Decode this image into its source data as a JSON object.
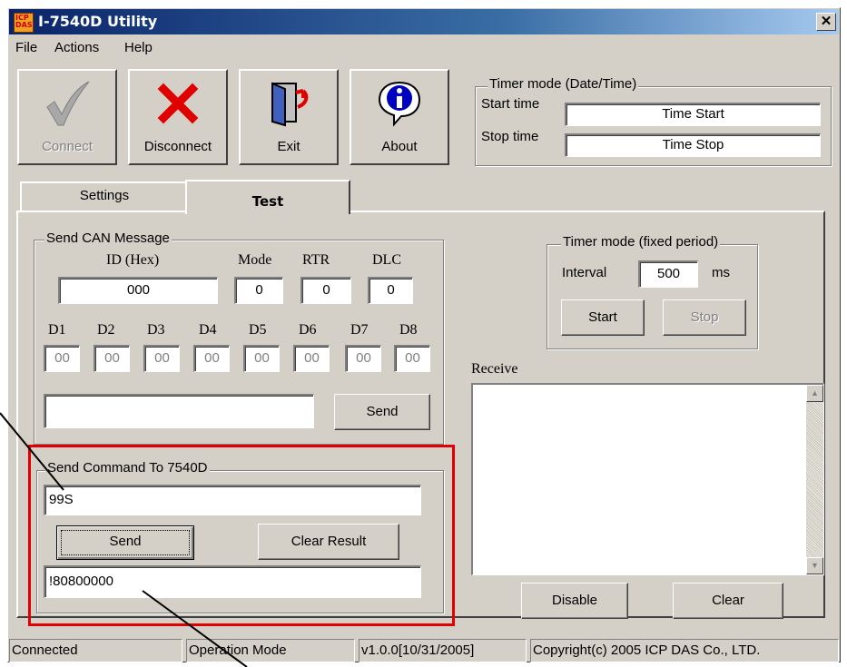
{
  "window": {
    "title": "I-7540D Utility",
    "icon_text": "ICP DAS",
    "close_label": "✕"
  },
  "menu": {
    "file": "File",
    "actions": "Actions",
    "help": "Help"
  },
  "toolbar": {
    "connect_label": "Connect",
    "disconnect_label": "Disconnect",
    "exit_label": "Exit",
    "about_label": "About"
  },
  "timer_datetime": {
    "legend": "Timer mode  (Date/Time)",
    "start_label": "Start time",
    "start_value": "Time Start",
    "stop_label": "Stop time",
    "stop_value": "Time Stop"
  },
  "tabs": {
    "settings": "Settings",
    "test": "Test"
  },
  "send_can": {
    "legend": "Send CAN Message",
    "id_label": "ID (Hex)",
    "mode_label": "Mode",
    "rtr_label": "RTR",
    "dlc_label": "DLC",
    "id_value": "000",
    "mode_value": "0",
    "rtr_value": "0",
    "dlc_value": "0",
    "d_labels": [
      "D1",
      "D2",
      "D3",
      "D4",
      "D5",
      "D6",
      "D7",
      "D8"
    ],
    "d_values": [
      "00",
      "00",
      "00",
      "00",
      "00",
      "00",
      "00",
      "00"
    ],
    "message_value": "",
    "send_label": "Send"
  },
  "timer_fixed": {
    "legend": "Timer mode (fixed period)",
    "interval_label": "Interval",
    "interval_value": "500",
    "unit": "ms",
    "start_label": "Start",
    "stop_label": "Stop"
  },
  "receive": {
    "label": "Receive",
    "disable_label": "Disable",
    "clear_label": "Clear"
  },
  "send_command": {
    "legend": "Send Command To 7540D",
    "command_value": "99S",
    "send_label": "Send",
    "clear_result_label": "Clear Result",
    "result_value": "!80800000"
  },
  "status": {
    "connection": "Connected",
    "mode": "Operation Mode",
    "version": "v1.0.0[10/31/2005]",
    "copyright": "Copyright(c) 2005 ICP DAS Co., LTD."
  },
  "colors": {
    "face": "#d4d0c8",
    "titlebar": "#0a246a",
    "highlight_box": "#e00000",
    "x_icon": "#e00000"
  }
}
